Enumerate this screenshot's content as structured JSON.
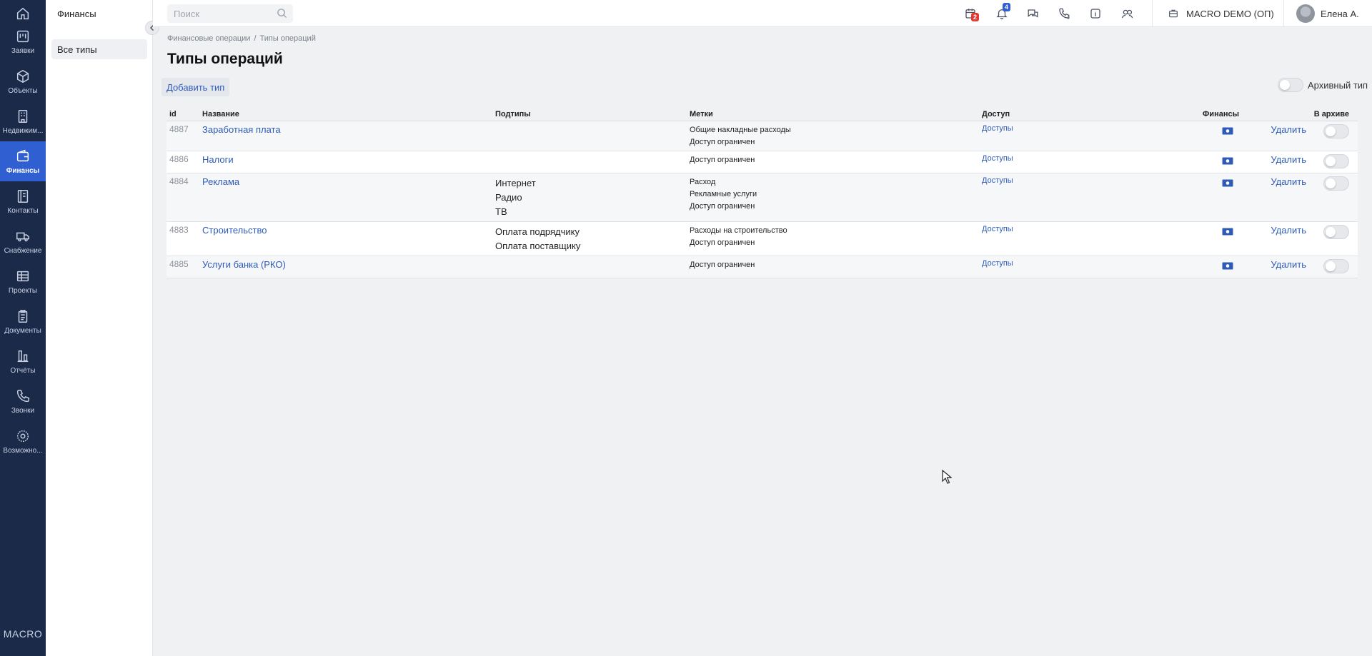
{
  "rail": {
    "items": [
      {
        "label": "Заявки",
        "icon": "kanban-icon"
      },
      {
        "label": "Объекты",
        "icon": "cube-icon"
      },
      {
        "label": "Недвижим...",
        "icon": "building-icon"
      },
      {
        "label": "Финансы",
        "icon": "wallet-icon",
        "active": true
      },
      {
        "label": "Контакты",
        "icon": "contacts-book-icon"
      },
      {
        "label": "Снабжение",
        "icon": "truck-icon"
      },
      {
        "label": "Проекты",
        "icon": "grid-icon"
      },
      {
        "label": "Документы",
        "icon": "clipboard-icon"
      },
      {
        "label": "Отчёты",
        "icon": "bar-chart-icon"
      },
      {
        "label": "Звонки",
        "icon": "phone-icon"
      },
      {
        "label": "Возможно...",
        "icon": "gear-icon"
      }
    ],
    "brand": "MACRO"
  },
  "subnav": {
    "title": "Финансы",
    "items": [
      {
        "label": "Все типы"
      }
    ]
  },
  "topbar": {
    "search_placeholder": "Поиск",
    "calendar_badge": "2",
    "notifications_badge": "4",
    "org_name": "MACRO DEMO (ОП)",
    "user_name": "Елена А."
  },
  "breadcrumbs": [
    "Финансовые операции",
    "Типы операций"
  ],
  "page": {
    "title": "Типы операций",
    "add_button": "Добавить тип",
    "archive_toggle_label": "Архивный тип"
  },
  "table": {
    "columns": {
      "id": "id",
      "name": "Название",
      "subtypes": "Подтипы",
      "tags": "Метки",
      "access": "Доступ",
      "finance": "Финансы",
      "archived": "В архиве"
    },
    "rows": [
      {
        "id": "4887",
        "name": "Заработная плата",
        "subtypes": [],
        "tags": [
          "Общие накладные расходы",
          "Доступ ограничен"
        ],
        "access": "Доступы",
        "delete": "Удалить",
        "archived": false
      },
      {
        "id": "4886",
        "name": "Налоги",
        "subtypes": [],
        "tags": [
          "Доступ ограничен"
        ],
        "access": "Доступы",
        "delete": "Удалить",
        "archived": false
      },
      {
        "id": "4884",
        "name": "Реклама",
        "subtypes": [
          "Интернет",
          "Радио",
          "ТВ"
        ],
        "tags": [
          "Расход",
          "Рекламные услуги",
          "Доступ ограничен"
        ],
        "access": "Доступы",
        "delete": "Удалить",
        "archived": false
      },
      {
        "id": "4883",
        "name": "Строительство",
        "subtypes": [
          "Оплата подрядчику",
          "Оплата поставщику"
        ],
        "tags": [
          "Расходы на строительство",
          "Доступ ограничен"
        ],
        "access": "Доступы",
        "delete": "Удалить",
        "archived": false
      },
      {
        "id": "4885",
        "name": "Услуги банка (РКО)",
        "subtypes": [],
        "tags": [
          "Доступ ограничен"
        ],
        "access": "Доступы",
        "delete": "Удалить",
        "archived": false
      }
    ]
  },
  "colors": {
    "rail_bg": "#1c2a4a",
    "active": "#2f5fd0",
    "link": "#2f5bb7",
    "badge_red": "#e53935",
    "badge_blue": "#2f5fd0"
  }
}
